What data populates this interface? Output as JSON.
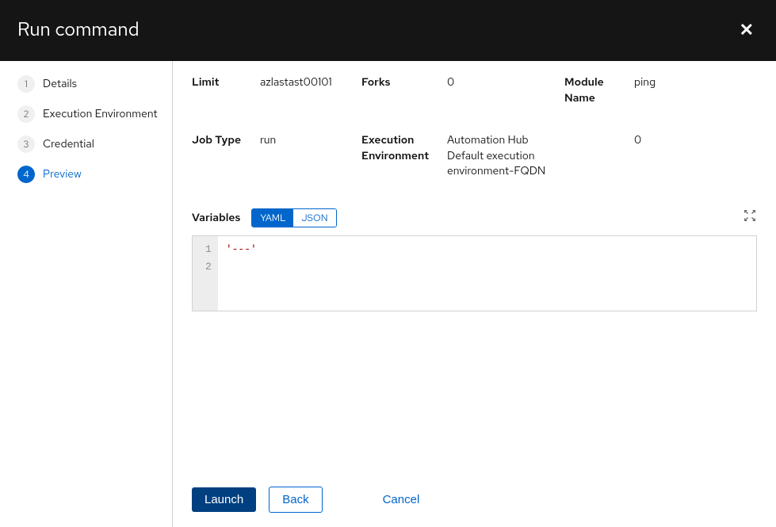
{
  "header": {
    "title": "Run command"
  },
  "wizard": {
    "steps": [
      {
        "num": "1",
        "label": "Details"
      },
      {
        "num": "2",
        "label": "Execution Environment"
      },
      {
        "num": "3",
        "label": "Credential"
      },
      {
        "num": "4",
        "label": "Preview"
      }
    ],
    "currentIndex": 3
  },
  "summary": {
    "limit_label": "Limit",
    "limit_value": "azlastast00101",
    "forks_label": "Forks",
    "forks_value": "0",
    "module_name_label": "Module Name",
    "module_name_value": "ping",
    "job_type_label": "Job Type",
    "job_type_value": "run",
    "exec_env_label": "Execution Environment",
    "exec_env_value": "Automation Hub Default execution environment-FQDN",
    "verbosity_label": "",
    "verbosity_value": "0"
  },
  "variables": {
    "label": "Variables",
    "yaml": "YAML",
    "json": "JSON",
    "line1": "1",
    "line2": "2",
    "content": "'---'"
  },
  "footer": {
    "launch": "Launch",
    "back": "Back",
    "cancel": "Cancel"
  }
}
